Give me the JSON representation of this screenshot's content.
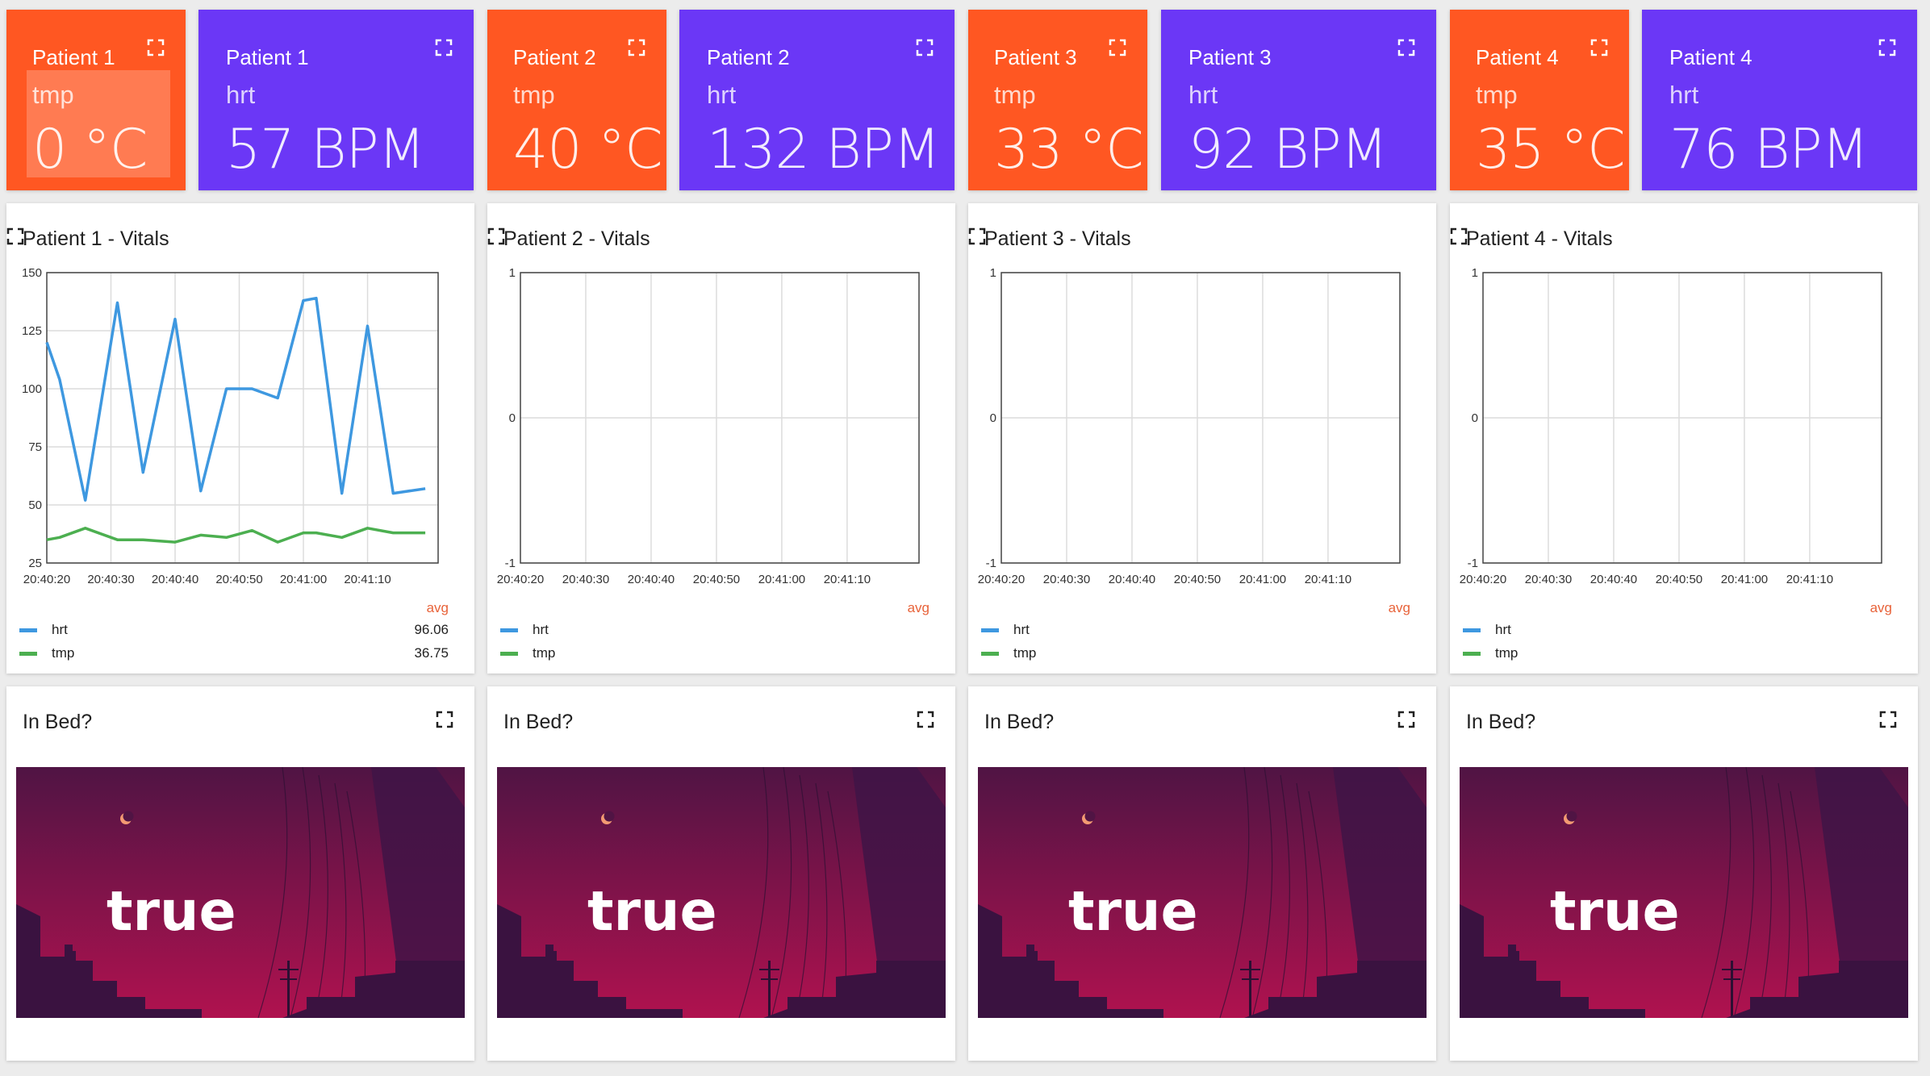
{
  "colors": {
    "temp_tile": "#ff5722",
    "hrt_tile": "#6b37f6",
    "hrt_series": "#3e98e0",
    "tmp_series": "#4caf50",
    "avg_label": "#e8633a",
    "bed_sky_top": "#501444",
    "bed_sky_bottom": "#b0124f"
  },
  "stat_tiles": [
    {
      "title": "Patient 1",
      "metric": "tmp",
      "value": "0 °C"
    },
    {
      "title": "Patient 1",
      "metric": "hrt",
      "value": "57 BPM"
    },
    {
      "title": "Patient 2",
      "metric": "tmp",
      "value": "40 °C"
    },
    {
      "title": "Patient 2",
      "metric": "hrt",
      "value": "132 BPM"
    },
    {
      "title": "Patient 3",
      "metric": "tmp",
      "value": "33 °C"
    },
    {
      "title": "Patient 3",
      "metric": "hrt",
      "value": "92 BPM"
    },
    {
      "title": "Patient 4",
      "metric": "tmp",
      "value": "35 °C"
    },
    {
      "title": "Patient 4",
      "metric": "hrt",
      "value": "76 BPM"
    }
  ],
  "vitals_cards": [
    {
      "title": "Patient 1 - Vitals",
      "avg_label": "avg",
      "legend": [
        {
          "name": "hrt",
          "avg": "96.06"
        },
        {
          "name": "tmp",
          "avg": "36.75"
        }
      ]
    },
    {
      "title": "Patient 2 - Vitals",
      "avg_label": "avg",
      "legend": [
        {
          "name": "hrt",
          "avg": ""
        },
        {
          "name": "tmp",
          "avg": ""
        }
      ]
    },
    {
      "title": "Patient 3 - Vitals",
      "avg_label": "avg",
      "legend": [
        {
          "name": "hrt",
          "avg": ""
        },
        {
          "name": "tmp",
          "avg": ""
        }
      ]
    },
    {
      "title": "Patient 4 - Vitals",
      "avg_label": "avg",
      "legend": [
        {
          "name": "hrt",
          "avg": ""
        },
        {
          "name": "tmp",
          "avg": ""
        }
      ]
    }
  ],
  "bed_cards": [
    {
      "title": "In Bed?",
      "value": "true"
    },
    {
      "title": "In Bed?",
      "value": "true"
    },
    {
      "title": "In Bed?",
      "value": "true"
    },
    {
      "title": "In Bed?",
      "value": "true"
    }
  ],
  "chart_data": [
    {
      "type": "line",
      "x_ticks": [
        "20:40:20",
        "20:40:30",
        "20:40:40",
        "20:40:50",
        "20:41:00",
        "20:41:10"
      ],
      "y_ticks": [
        150,
        125,
        100,
        75,
        50,
        25
      ],
      "ylim": [
        25,
        150
      ],
      "xlim": [
        "20:40:20",
        "20:41:21"
      ],
      "grid": true,
      "x": [
        "20:40:20",
        "20:40:22",
        "20:40:26",
        "20:40:31",
        "20:40:35",
        "20:40:40",
        "20:40:44",
        "20:40:48",
        "20:40:52",
        "20:40:56",
        "20:41:00",
        "20:41:02",
        "20:41:06",
        "20:41:10",
        "20:41:14",
        "20:41:19"
      ],
      "series": [
        {
          "name": "hrt",
          "values": [
            120,
            104,
            52,
            137,
            64,
            130,
            56,
            100,
            100,
            96,
            138,
            139,
            55,
            127,
            55,
            57
          ]
        },
        {
          "name": "tmp",
          "values": [
            35,
            36,
            40,
            35,
            35,
            34,
            37,
            36,
            39,
            34,
            38,
            38,
            36,
            40,
            38,
            38
          ]
        }
      ]
    },
    {
      "type": "line",
      "x_ticks": [
        "20:40:20",
        "20:40:30",
        "20:40:40",
        "20:40:50",
        "20:41:00",
        "20:41:10"
      ],
      "y_ticks": [
        1,
        0,
        -1
      ],
      "ylim": [
        -1,
        1
      ],
      "grid": true,
      "series": [
        {
          "name": "hrt",
          "values": []
        },
        {
          "name": "tmp",
          "values": []
        }
      ]
    },
    {
      "type": "line",
      "x_ticks": [
        "20:40:20",
        "20:40:30",
        "20:40:40",
        "20:40:50",
        "20:41:00",
        "20:41:10"
      ],
      "y_ticks": [
        1,
        0,
        -1
      ],
      "ylim": [
        -1,
        1
      ],
      "grid": true,
      "series": [
        {
          "name": "hrt",
          "values": []
        },
        {
          "name": "tmp",
          "values": []
        }
      ]
    },
    {
      "type": "line",
      "x_ticks": [
        "20:40:20",
        "20:40:30",
        "20:40:40",
        "20:40:50",
        "20:41:00",
        "20:41:10"
      ],
      "y_ticks": [
        1,
        0,
        -1
      ],
      "ylim": [
        -1,
        1
      ],
      "grid": true,
      "series": [
        {
          "name": "hrt",
          "values": []
        },
        {
          "name": "tmp",
          "values": []
        }
      ]
    }
  ]
}
